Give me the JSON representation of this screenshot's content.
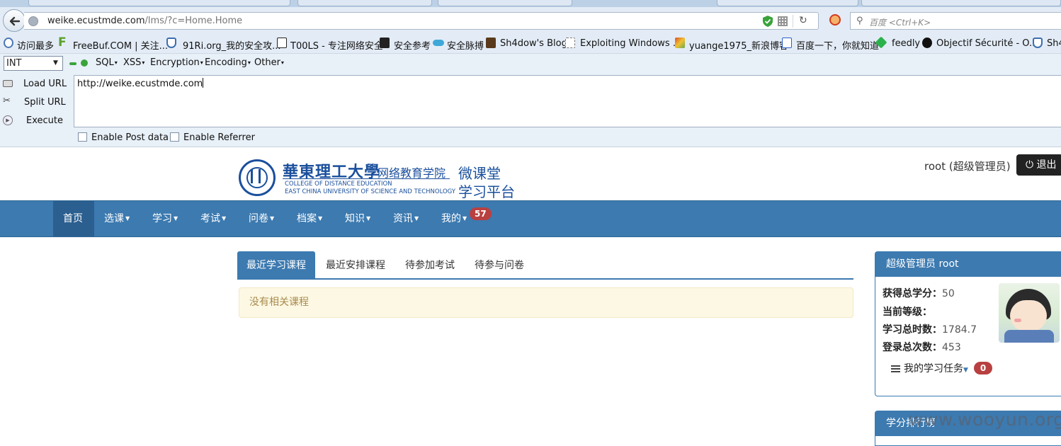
{
  "browser": {
    "url_host": "weike.ecustmde.com",
    "url_path": "/lms/?c=Home.Home",
    "search_placeholder": "百度 <Ctrl+K>"
  },
  "bookmarks": [
    {
      "label": "访问最多",
      "icon": "globe-icon",
      "color": "#4b78b5"
    },
    {
      "label": "FreeBuf.COM | 关注...",
      "icon": "freebuf-icon",
      "color": "#5aa02c"
    },
    {
      "label": "91Ri.org_我的安全攻...",
      "icon": "shield-icon",
      "color": "#3b6fb0"
    },
    {
      "label": "T00LS - 专注网络安全",
      "icon": "tools-icon",
      "color": "#222222"
    },
    {
      "label": "安全参考",
      "icon": "dark-icon",
      "color": "#222222"
    },
    {
      "label": "安全脉搏",
      "icon": "cloud-icon",
      "color": "#3fa8d8"
    },
    {
      "label": "Sh4dow's Blog",
      "icon": "avatar-icon",
      "color": "#5a3a1a"
    },
    {
      "label": "Exploiting Windows ...",
      "icon": "page-icon",
      "color": "#ffffff"
    },
    {
      "label": "yuange1975_新浪博客",
      "icon": "colorful-icon",
      "color": "#d94f2a"
    },
    {
      "label": "百度一下，你就知道",
      "icon": "paw-icon",
      "color": "#2d5fc9"
    },
    {
      "label": "feedly",
      "icon": "feedly-icon",
      "color": "#2bb24c"
    },
    {
      "label": "Objectif Sécurité - O...",
      "icon": "os-icon",
      "color": "#111111"
    },
    {
      "label": "Sh4",
      "icon": "shield-icon",
      "color": "#3b6fb0"
    }
  ],
  "hackbar": {
    "select_value": "INT",
    "menus": [
      "SQL",
      "XSS",
      "Encryption",
      "Encoding",
      "Other"
    ],
    "load_url": "Load URL",
    "split_url": "Split URL",
    "execute": "Execute",
    "textarea_value": "http://weike.ecustmde.com",
    "enable_post": "Enable Post data",
    "enable_referrer": "Enable Referrer"
  },
  "site": {
    "logo_cn": "華東理工大學",
    "logo_dept": "网络教育学院",
    "logo_en1": "COLLEGE OF DISTANCE EDUCATION",
    "logo_en2": "EAST CHINA UNIVERSITY OF SCIENCE AND TECHNOLOGY",
    "platform_line1": "微课堂",
    "platform_line2": "学习平台",
    "user": "root (超级管理员)",
    "logout": "退出"
  },
  "nav": {
    "items": [
      "首页",
      "选课",
      "学习",
      "考试",
      "问卷",
      "档案",
      "知识",
      "资讯",
      "我的"
    ],
    "badge": "57"
  },
  "content": {
    "tabs": [
      "最近学习课程",
      "最近安排课程",
      "待参加考试",
      "待参与问卷"
    ],
    "empty_message": "没有相关课程"
  },
  "panel": {
    "title": "超级管理员 root",
    "credit_label": "获得总学分：",
    "credit_value": "50",
    "level_label": "当前等级：",
    "level_value": "",
    "hours_label": "学习总时数：",
    "hours_value": "1784.7",
    "logins_label": "登录总次数：",
    "logins_value": "453",
    "task_label": "我的学习任务",
    "task_badge": "0",
    "ranking_title": "学分排行榜"
  },
  "watermark": "www.wooyun.org",
  "colors": {
    "nav": "#3c7ab0",
    "nav_active": "#2b5f8f",
    "badge": "#b94040",
    "alert_bg": "#fcf8e3"
  }
}
